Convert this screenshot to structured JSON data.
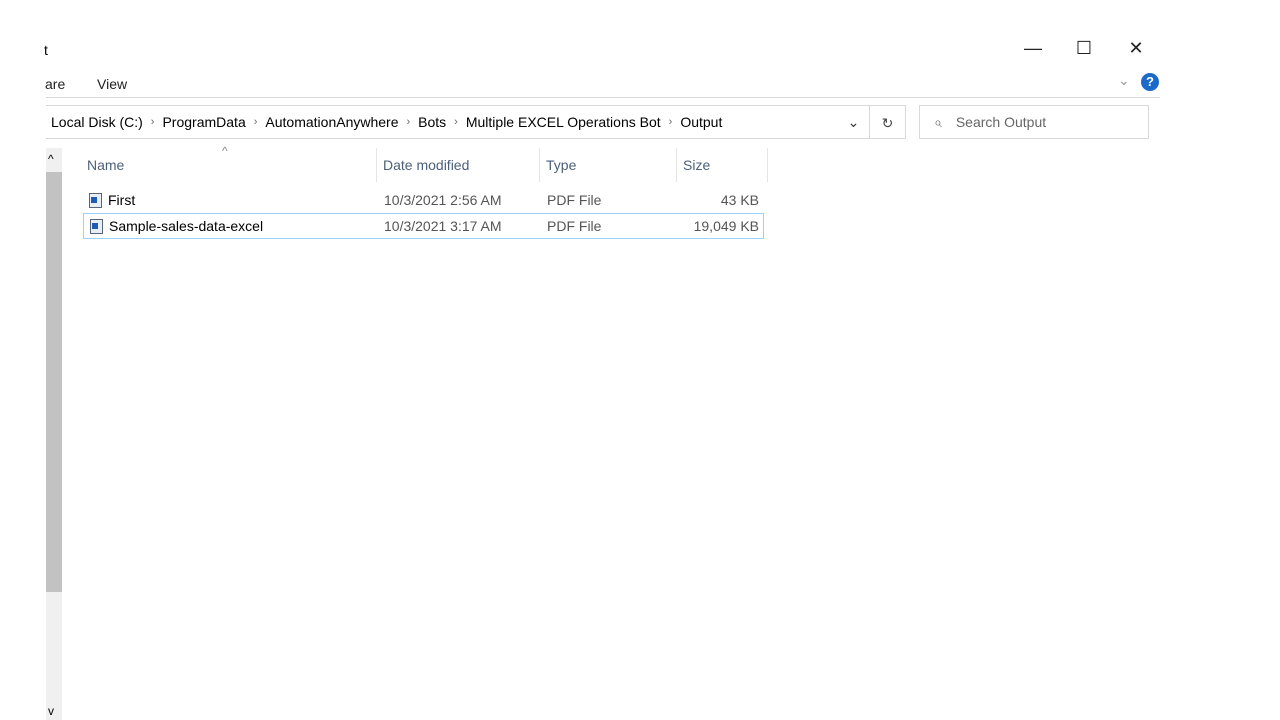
{
  "window": {
    "title": "t",
    "minimize": "—",
    "maximize": "☐",
    "close": "✕"
  },
  "ribbon": {
    "tabs": [
      "are",
      "View"
    ],
    "expand": "⌄",
    "help": "?"
  },
  "address": {
    "crumbs": [
      "Local Disk (C:)",
      "ProgramData",
      "AutomationAnywhere",
      "Bots",
      "Multiple EXCEL Operations Bot",
      "Output"
    ],
    "separator": "›",
    "dropdown": "⌄",
    "refresh": "↻"
  },
  "search": {
    "placeholder": "Search Output",
    "icon": "⌕"
  },
  "columns": {
    "sort_indicator": "^",
    "name": "Name",
    "date": "Date modified",
    "type": "Type",
    "size": "Size"
  },
  "files": [
    {
      "name": "First",
      "date": "10/3/2021 2:56 AM",
      "type": "PDF File",
      "size": "43 KB"
    },
    {
      "name": "Sample-sales-data-excel",
      "date": "10/3/2021 3:17 AM",
      "type": "PDF File",
      "size": "19,049 KB"
    }
  ],
  "scrollbar": {
    "up": "^",
    "down": "v"
  }
}
